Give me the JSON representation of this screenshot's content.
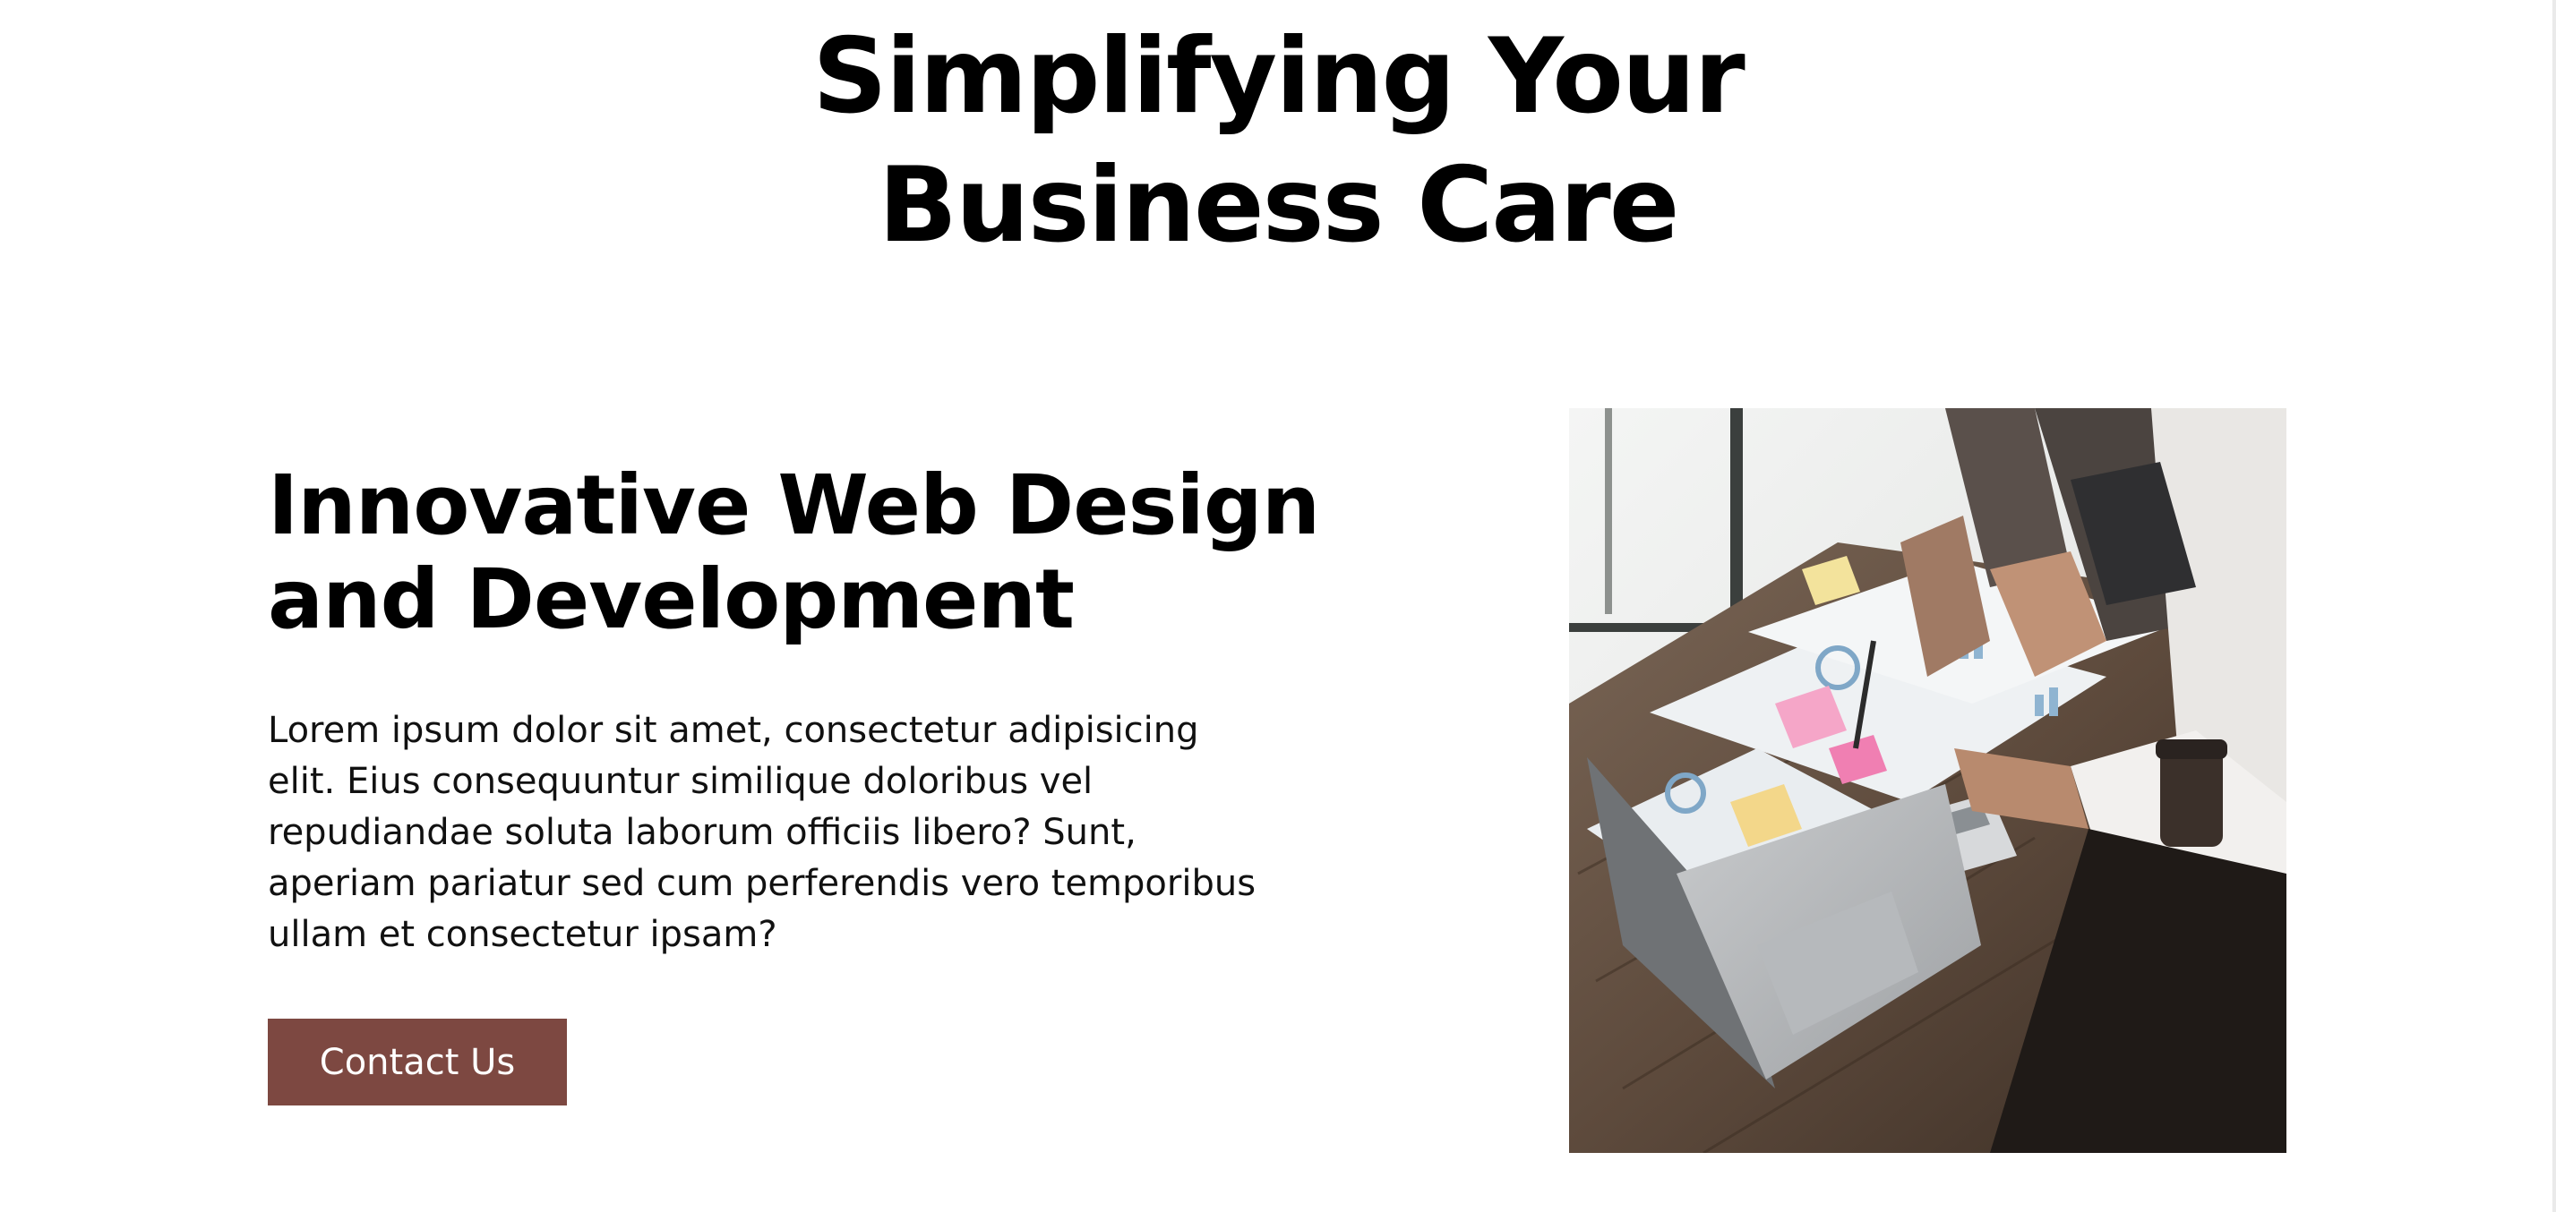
{
  "hero": {
    "title_line1": "Simplifying Your",
    "title_line2": "Business Care"
  },
  "section": {
    "heading_line1": "Innovative Web Design",
    "heading_line2": "and Development",
    "body": "Lorem ipsum dolor sit amet, consectetur adipisicing elit. Eius consequuntur similique doloribus vel repudiandae soluta laborum officiis libero? Sunt, aperiam pariatur sed cum perferendis vero temporibus ullam et consectetur ipsam?",
    "cta_label": "Contact Us"
  },
  "image": {
    "subject": "team-working-at-desk-photo"
  },
  "colors": {
    "accent": "#7d4841",
    "text": "#000000",
    "background": "#ffffff"
  }
}
